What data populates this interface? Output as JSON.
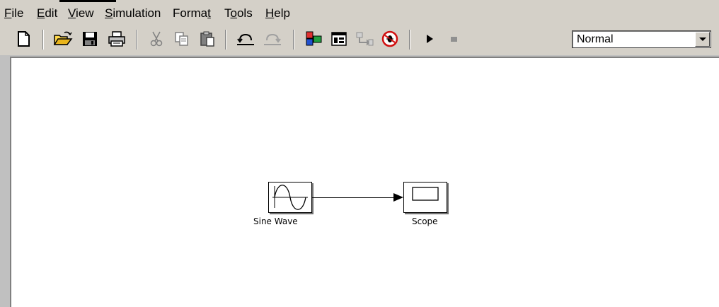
{
  "menubar": {
    "items": [
      {
        "id": "file",
        "label": "File",
        "mnemonic_index": 0
      },
      {
        "id": "edit",
        "label": "Edit",
        "mnemonic_index": 0
      },
      {
        "id": "view",
        "label": "View",
        "mnemonic_index": 0
      },
      {
        "id": "simulation",
        "label": "Simulation",
        "mnemonic_index": 0
      },
      {
        "id": "format",
        "label": "Format",
        "mnemonic_index": 5
      },
      {
        "id": "tools",
        "label": "Tools",
        "mnemonic_index": 1
      },
      {
        "id": "help",
        "label": "Help",
        "mnemonic_index": 0
      }
    ]
  },
  "toolbar": {
    "buttons": [
      {
        "id": "new",
        "icon": "new-document-icon"
      },
      {
        "id": "open",
        "icon": "open-folder-icon"
      },
      {
        "id": "save",
        "icon": "save-disk-icon"
      },
      {
        "id": "print",
        "icon": "printer-icon"
      },
      {
        "id": "cut",
        "icon": "cut-icon",
        "disabled": true
      },
      {
        "id": "copy",
        "icon": "copy-icon",
        "disabled": true
      },
      {
        "id": "paste",
        "icon": "paste-icon"
      },
      {
        "id": "undo",
        "icon": "undo-icon"
      },
      {
        "id": "redo",
        "icon": "redo-icon",
        "disabled": true
      },
      {
        "id": "library-browser",
        "icon": "library-browser-icon"
      },
      {
        "id": "toggle-model-browser",
        "icon": "model-browser-icon"
      },
      {
        "id": "go-to-parent",
        "icon": "go-to-parent-icon",
        "disabled": true
      },
      {
        "id": "debug",
        "icon": "debug-icon"
      },
      {
        "id": "start-simulation",
        "icon": "play-icon"
      },
      {
        "id": "stop-simulation",
        "icon": "stop-icon",
        "disabled": true
      }
    ],
    "simulation_mode": {
      "selected": "Normal"
    }
  },
  "canvas": {
    "blocks": [
      {
        "id": "sine-wave",
        "label": "Sine Wave",
        "icon": "sine-wave-icon"
      },
      {
        "id": "scope",
        "label": "Scope",
        "icon": "scope-screen-icon"
      }
    ],
    "connections": [
      {
        "from": "Sine Wave",
        "to": "Scope"
      }
    ]
  },
  "colors": {
    "chrome": "#d4d0c8",
    "canvas": "#ffffff",
    "shadow": "#808080",
    "highlight": "#ffffff"
  }
}
